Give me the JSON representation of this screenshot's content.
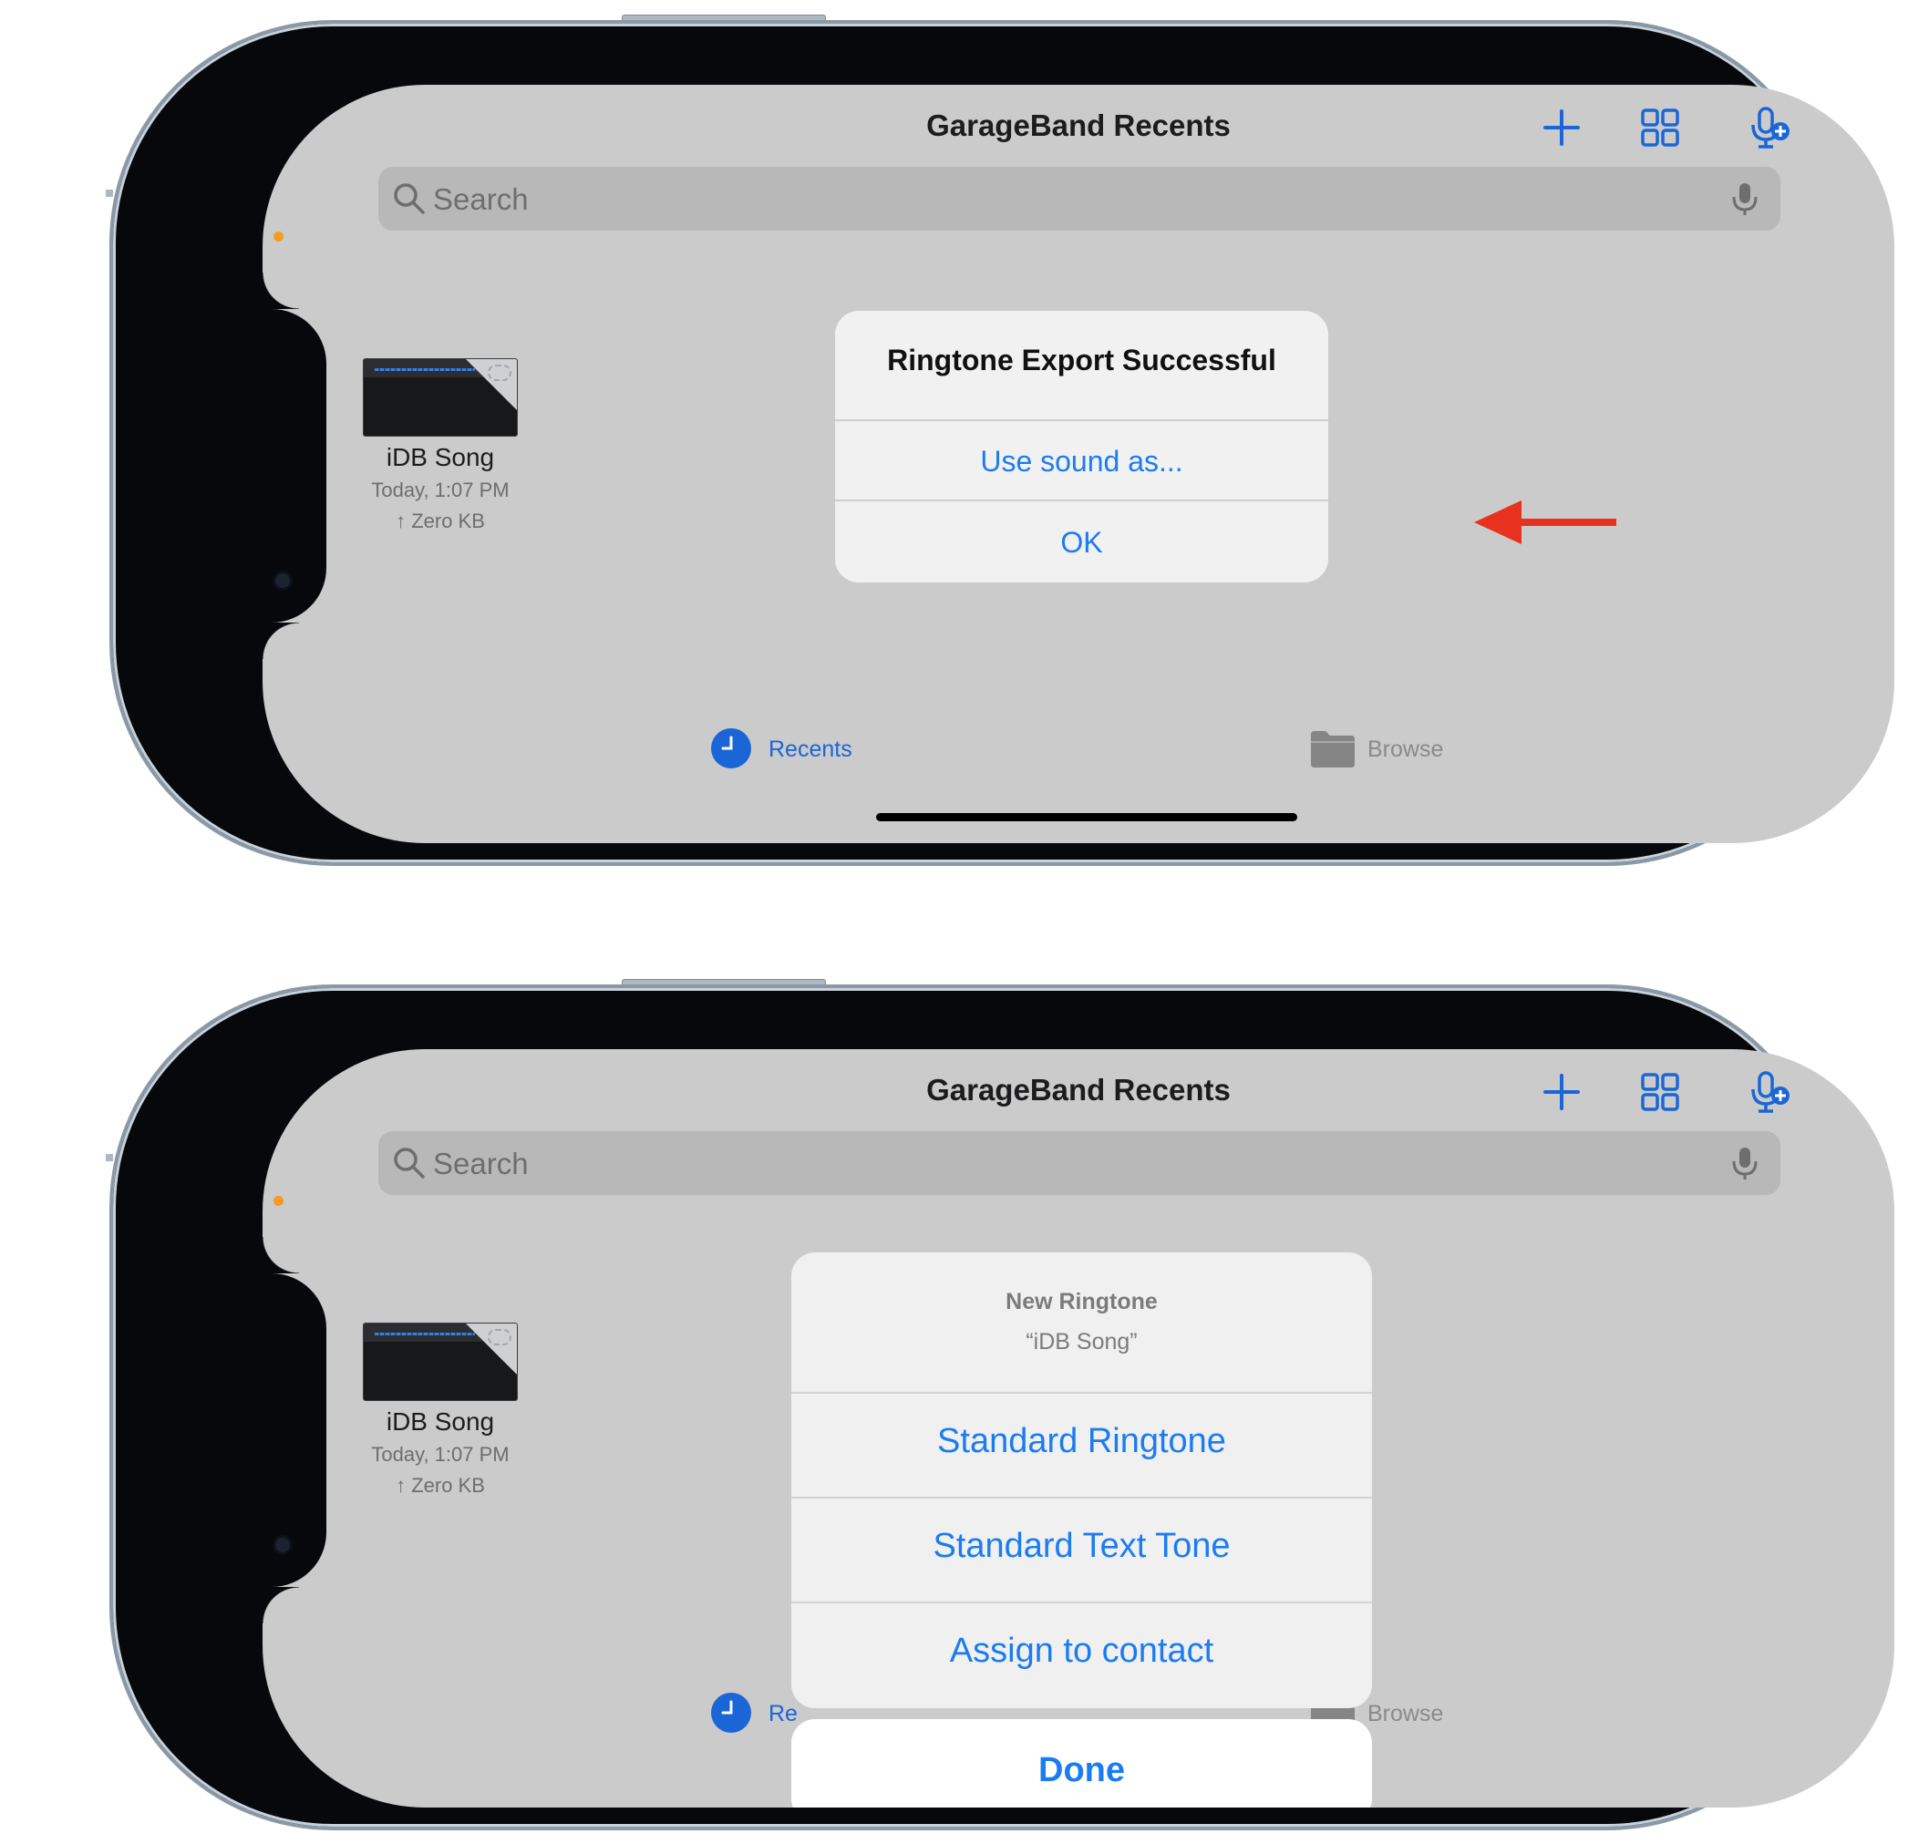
{
  "screens": [
    {
      "header": {
        "title": "GarageBand Recents"
      },
      "search": {
        "placeholder": "Search"
      },
      "file": {
        "name": "iDB Song",
        "date": "Today, 1:07 PM",
        "size": "↑ Zero KB"
      },
      "tabs": {
        "recents": "Recents",
        "browse": "Browse"
      },
      "alert": {
        "title": "Ringtone Export Successful",
        "use_sound_as": "Use sound as...",
        "ok": "OK"
      },
      "annotation": {
        "arrow_color": "#e8321f"
      }
    },
    {
      "header": {
        "title": "GarageBand Recents"
      },
      "search": {
        "placeholder": "Search"
      },
      "file": {
        "name": "iDB Song",
        "date": "Today, 1:07 PM",
        "size": "↑ Zero KB"
      },
      "tabs": {
        "recents": "Re",
        "browse": "Browse"
      },
      "action_sheet": {
        "title": "New Ringtone",
        "subtitle": "“iDB Song”",
        "options": [
          "Standard Ringtone",
          "Standard Text Tone",
          "Assign to contact"
        ],
        "done": "Done"
      }
    }
  ],
  "colors": {
    "accent": "#1b7cf2",
    "screen_bg": "#cbcbcb",
    "tab_active": "#1b66d6"
  },
  "icons": [
    "plus-icon",
    "grid-icon",
    "mic-plus-icon",
    "search-icon",
    "mic-icon",
    "clock-icon",
    "folder-icon"
  ]
}
